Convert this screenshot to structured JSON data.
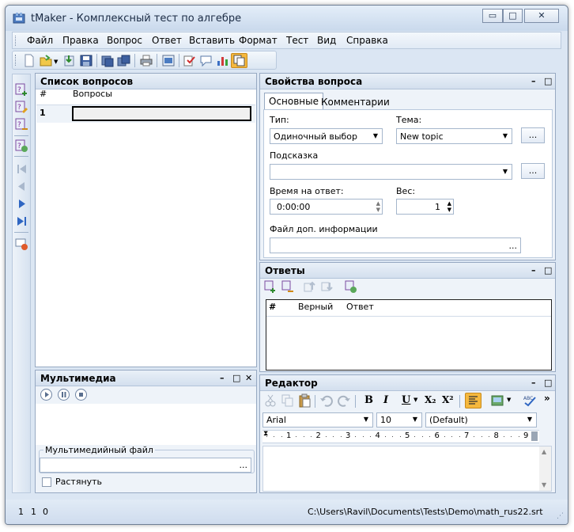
{
  "window": {
    "title": "tMaker - Комплексный тест по алгебре"
  },
  "menu": [
    "Файл",
    "Правка",
    "Вопрос",
    "Ответ",
    "Вставить",
    "Формат",
    "Тест",
    "Вид",
    "Справка"
  ],
  "question_list": {
    "title": "Список вопросов",
    "col_number": "#",
    "col_questions": "Вопросы",
    "rows": [
      {
        "number": "1",
        "text": ""
      }
    ]
  },
  "multimedia": {
    "title": "Мультимедиа",
    "file_group_label": "Мультимедийный файл",
    "file_value": "",
    "browse": "...",
    "stretch_label": "Растянуть",
    "stretch_checked": false
  },
  "properties": {
    "title": "Свойства вопроса",
    "tabs": [
      "Основные",
      "Комментарии"
    ],
    "active_tab": "Основные",
    "type_label": "Тип:",
    "type_value": "Одиночный выбор",
    "topic_label": "Тема:",
    "topic_value": "New topic",
    "topic_browse": "...",
    "hint_label": "Подсказка",
    "hint_value": "",
    "hint_browse": "...",
    "time_label": "Время на ответ:",
    "time_value": "0:00:00",
    "weight_label": "Вес:",
    "weight_value": "1",
    "extra_file_label": "Файл доп. информации",
    "extra_file_browse": "..."
  },
  "answers": {
    "title": "Ответы",
    "col_number": "#",
    "col_correct": "Верный",
    "col_answer": "Ответ"
  },
  "editor": {
    "title": "Редактор",
    "font": "Arial",
    "size": "10",
    "style": "(Default)",
    "bold": "B",
    "italic": "I",
    "underline": "U",
    "subscript": "X₂",
    "superscript": "X²",
    "overflow": "»",
    "ruler": [
      "1",
      "2",
      "3",
      "4",
      "5",
      "6",
      "7",
      "8",
      "9"
    ]
  },
  "status": {
    "line": "1",
    "col": "1",
    "count": "0",
    "path": "C:\\Users\\Ravil\\Documents\\Tests\\Demo\\math_rus22.srt"
  },
  "icons": {
    "left_toolbar": [
      "add-question-icon",
      "edit-question-icon",
      "delete-question-icon",
      "import-question-icon",
      "first-icon",
      "prev-icon",
      "next-icon",
      "last-icon",
      "preview-icon"
    ],
    "top_toolbar": [
      "new-icon",
      "open-icon",
      "import-icon",
      "save-icon",
      "save-as-icon",
      "save-all-icon",
      "print-icon",
      "preview-icon",
      "check-icon",
      "comment-icon",
      "chart-icon",
      "copy-icon"
    ]
  },
  "colors": {
    "accent": "#f5b83d",
    "frame": "#dbe6f3",
    "header": "#d3dfee"
  }
}
